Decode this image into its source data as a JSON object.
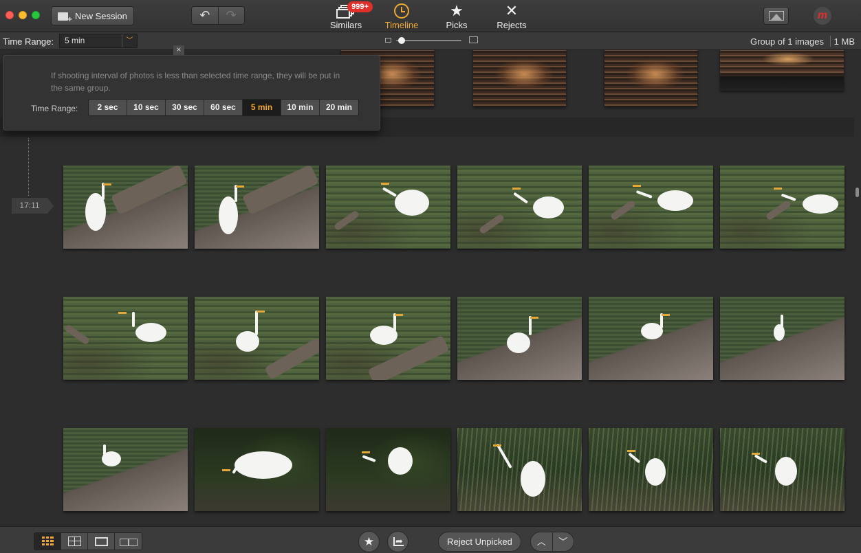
{
  "titlebar": {
    "new_session_label": "New Session",
    "undo_icon": "undo-arrow-icon",
    "redo_icon": "redo-arrow-icon",
    "nav": [
      {
        "id": "similars",
        "label": "Similars",
        "icon": "photo-stack-icon",
        "badge": "999+"
      },
      {
        "id": "timeline",
        "label": "Timeline",
        "icon": "clock-icon",
        "active": true
      },
      {
        "id": "picks",
        "label": "Picks",
        "icon": "star-icon"
      },
      {
        "id": "rejects",
        "label": "Rejects",
        "icon": "x-mark-icon"
      }
    ],
    "logo_letter": "m"
  },
  "subbar": {
    "time_range_label": "Time Range:",
    "time_range_value": "5 min",
    "group_info": "Group of 1 images",
    "size_info": "1 MB",
    "zoom_level": 0.05
  },
  "popover": {
    "description": "If shooting interval of photos is less than selected time range, they will be put in the same group.",
    "label": "Time Range:",
    "close_glyph": "×",
    "options": [
      "2 sec",
      "10 sec",
      "30 sec",
      "60 sec",
      "5 min",
      "10 min",
      "20 min"
    ],
    "selected": "5 min"
  },
  "timeline": {
    "time_marker": "17:11"
  },
  "bottombar": {
    "views": [
      "grid-large-icon",
      "grid-medium-icon",
      "single-view-icon",
      "compare-view-icon"
    ],
    "selected_view": 0,
    "reject_unpicked_label": "Reject Unpicked",
    "up_glyph": "︿",
    "down_glyph": "﹀"
  },
  "colors": {
    "accent": "#f0a830",
    "badge": "#e0302b",
    "background": "#2d2d2d"
  }
}
